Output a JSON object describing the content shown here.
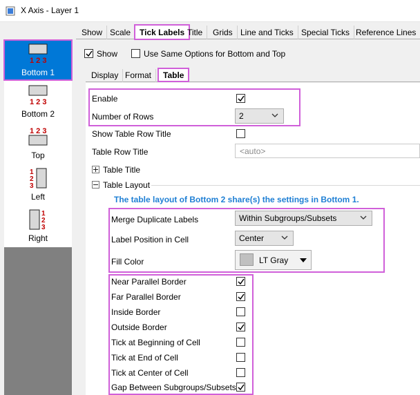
{
  "window": {
    "title": "X Axis - Layer 1"
  },
  "sidebar": {
    "items": [
      {
        "label": "Bottom 1",
        "icon": "axis-bottom-1-icon",
        "selected": true
      },
      {
        "label": "Bottom 2",
        "icon": "axis-bottom-2-icon"
      },
      {
        "label": "Top",
        "icon": "axis-top-icon"
      },
      {
        "label": "Left",
        "icon": "axis-left-icon"
      },
      {
        "label": "Right",
        "icon": "axis-right-icon"
      }
    ]
  },
  "main_tabs": [
    "Show",
    "Scale",
    "Tick Labels",
    "Title",
    "Grids",
    "Line and Ticks",
    "Special Ticks",
    "Reference Lines"
  ],
  "main_tab_active": "Tick Labels",
  "show": {
    "label": "Show",
    "checked": true
  },
  "same_options": {
    "label": "Use Same Options for Bottom and Top",
    "checked": false
  },
  "sub_tabs": [
    "Display",
    "Format",
    "Table"
  ],
  "sub_tab_active": "Table",
  "table": {
    "enable": {
      "label": "Enable",
      "checked": true
    },
    "rows": {
      "label": "Number of Rows",
      "value": "2"
    },
    "show_row_title": {
      "label": "Show Table Row Title",
      "checked": false
    },
    "row_title": {
      "label": "Table Row Title",
      "placeholder": "<auto>"
    },
    "table_title": {
      "label": "Table Title"
    },
    "table_layout": {
      "label": "Table Layout"
    },
    "note": "The table layout of Bottom 2 share(s) the settings in Bottom 1.",
    "merge": {
      "label": "Merge Duplicate Labels",
      "value": "Within Subgroups/Subsets"
    },
    "position": {
      "label": "Label Position in Cell",
      "value": "Center"
    },
    "fill": {
      "label": "Fill Color",
      "value": "LT Gray",
      "color": "#c0c0c0"
    },
    "checks": [
      {
        "label": "Near Parallel Border",
        "checked": true
      },
      {
        "label": "Far Parallel Border",
        "checked": true
      },
      {
        "label": "Inside Border",
        "checked": false
      },
      {
        "label": "Outside Border",
        "checked": true
      },
      {
        "label": "Tick at Beginning of Cell",
        "checked": false
      },
      {
        "label": "Tick at End of Cell",
        "checked": false
      },
      {
        "label": "Tick at Center of Cell",
        "checked": false
      },
      {
        "label": "Gap Between Subgroups/Subsets",
        "checked": true
      }
    ]
  },
  "colors": {
    "highlight": "#d05fd9",
    "selected": "#0078d7",
    "note": "#1e7fd4"
  }
}
